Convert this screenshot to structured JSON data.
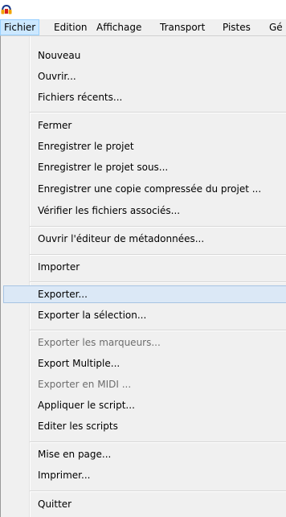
{
  "menubar": {
    "items": [
      {
        "label": "Fichier"
      },
      {
        "label": "Edition"
      },
      {
        "label": "Affichage"
      },
      {
        "label": "Transport"
      },
      {
        "label": "Pistes"
      },
      {
        "label": "Gé"
      }
    ]
  },
  "menu": {
    "items": [
      {
        "label": "Nouveau"
      },
      {
        "label": "Ouvrir..."
      },
      {
        "label": "Fichiers récents..."
      },
      {
        "label": "Fermer"
      },
      {
        "label": "Enregistrer le projet"
      },
      {
        "label": "Enregistrer le projet sous..."
      },
      {
        "label": "Enregistrer une copie compressée du projet ..."
      },
      {
        "label": "Vérifier les fichiers associés..."
      },
      {
        "label": "Ouvrir l'éditeur de métadonnées..."
      },
      {
        "label": "Importer"
      },
      {
        "label": "Exporter..."
      },
      {
        "label": "Exporter la sélection..."
      },
      {
        "label": "Exporter les marqueurs..."
      },
      {
        "label": "Export Multiple..."
      },
      {
        "label": "Exporter en MIDI ..."
      },
      {
        "label": "Appliquer le script..."
      },
      {
        "label": "Editer les scripts"
      },
      {
        "label": "Mise en page..."
      },
      {
        "label": "Imprimer..."
      },
      {
        "label": "Quitter"
      }
    ]
  },
  "colors": {
    "menu_bg": "#f0f0f0",
    "hover_bg": "#dbe8f6",
    "hover_border": "#a7c4e3",
    "active_menubar_bg": "#cce8ff",
    "disabled_text": "#6d6d6d"
  }
}
